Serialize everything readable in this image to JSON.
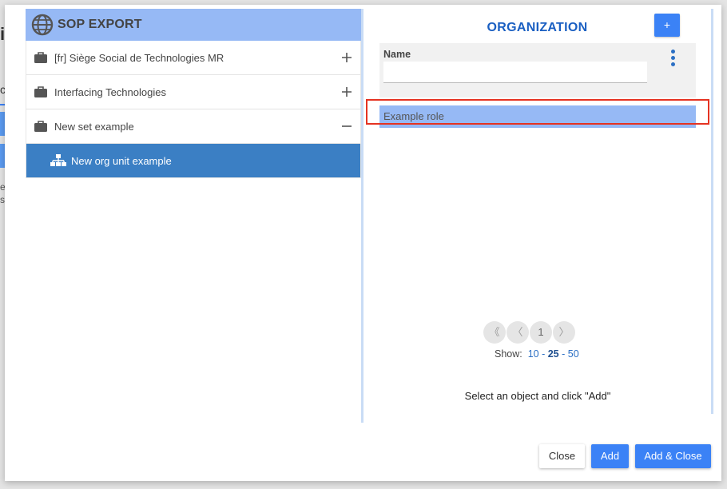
{
  "background": {
    "title_fragment": "i",
    "tab_fragment": "c",
    "text_fragment_1": "el",
    "text_fragment_2": "s:"
  },
  "left_panel": {
    "title": "SOP EXPORT",
    "items": [
      {
        "label": "[fr] Siège Social de Technologies MR",
        "icon": "briefcase-icon",
        "toggle": "plus"
      },
      {
        "label": "Interfacing Technologies",
        "icon": "briefcase-icon",
        "toggle": "plus"
      },
      {
        "label": "New set example",
        "icon": "briefcase-icon",
        "toggle": "minus"
      }
    ],
    "selected_child": {
      "label": "New org unit example",
      "icon": "org-chart-icon"
    }
  },
  "right_panel": {
    "title": "ORGANIZATION",
    "add_button": "+",
    "filter": {
      "name_label": "Name",
      "name_value": ""
    },
    "results": [
      {
        "label": "Example role"
      }
    ],
    "pager": {
      "first": "《",
      "prev": "〈",
      "page": "1",
      "next": "〉"
    },
    "show": {
      "label": "Show:",
      "options": [
        "10",
        "25",
        "50"
      ],
      "selected": "25"
    },
    "hint": "Select an object and click \"Add\""
  },
  "footer": {
    "close_label": "Close",
    "add_label": "Add",
    "add_close_label": "Add & Close"
  },
  "colors": {
    "accent": "#3b82f6",
    "header_bg": "#96b9f5",
    "selected_bg": "#3b7fc4",
    "title_blue": "#1a5fc2",
    "highlight_red": "#e53322"
  }
}
